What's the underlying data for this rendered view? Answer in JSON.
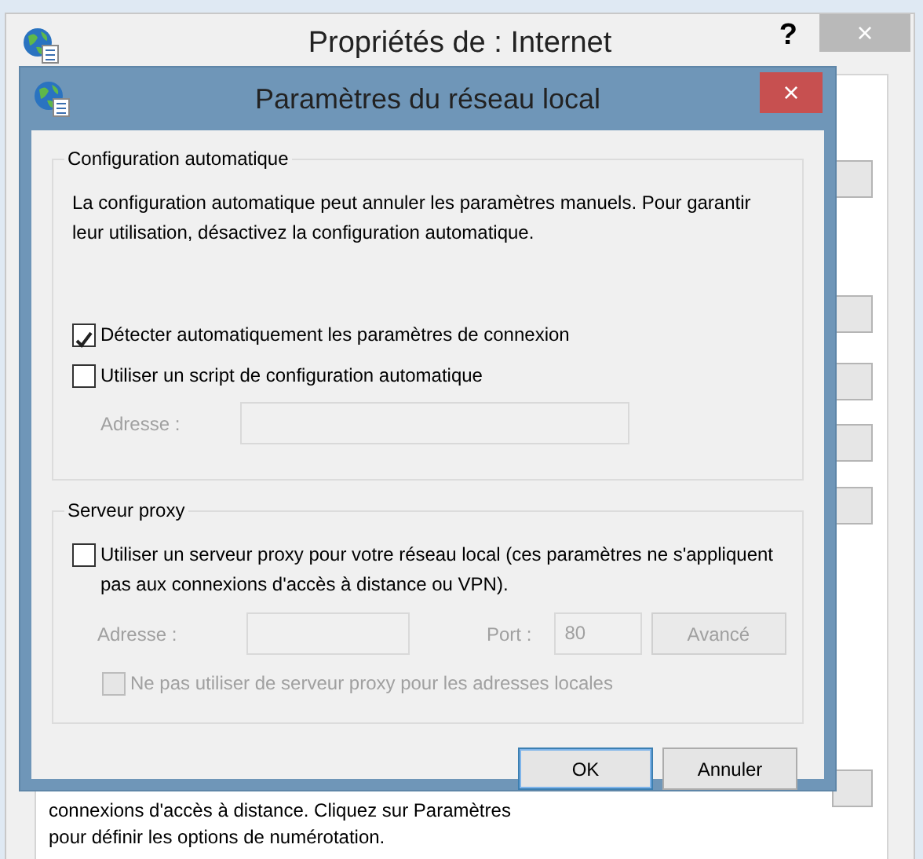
{
  "background_window": {
    "title": "Propriétés de : Internet",
    "help_button": "?",
    "close_button": "×",
    "text_lines": [
      "connexions d'accès à distance. Cliquez sur Paramètres",
      "pour définir les options de numérotation."
    ]
  },
  "dialog": {
    "title": "Paramètres du réseau local",
    "close_button": "×",
    "groups": [
      {
        "title": "Configuration automatique",
        "description": "La configuration automatique peut annuler les paramètres manuels. Pour garantir leur utilisation, désactivez la configuration automatique.",
        "options": [
          {
            "kind": "checkbox",
            "label": "Détecter automatiquement les paramètres de connexion",
            "checked": true,
            "disabled": false
          },
          {
            "kind": "checkbox",
            "label": "Utiliser un script de configuration automatique",
            "checked": false,
            "disabled": false
          },
          {
            "kind": "address",
            "label": "Adresse :",
            "disabled": true
          }
        ]
      },
      {
        "title": "Serveur proxy",
        "options": [
          {
            "kind": "checkbox",
            "label": "Utiliser un serveur proxy pour votre réseau local (ces paramètres ne s'appliquent pas aux connexions d'accès à distance ou VPN).",
            "checked": false,
            "disabled": false
          },
          {
            "kind": "proxy_address",
            "label": "Adresse :",
            "port_label": "Port :",
            "port_value": "80",
            "button": "Avancé",
            "disabled": true
          },
          {
            "kind": "checkbox",
            "label": "Ne pas utiliser de serveur proxy pour les adresses locales",
            "checked": false,
            "disabled": true
          }
        ]
      }
    ],
    "buttons": [
      {
        "label": "OK",
        "default": true
      },
      {
        "label": "Annuler",
        "default": false
      }
    ]
  }
}
